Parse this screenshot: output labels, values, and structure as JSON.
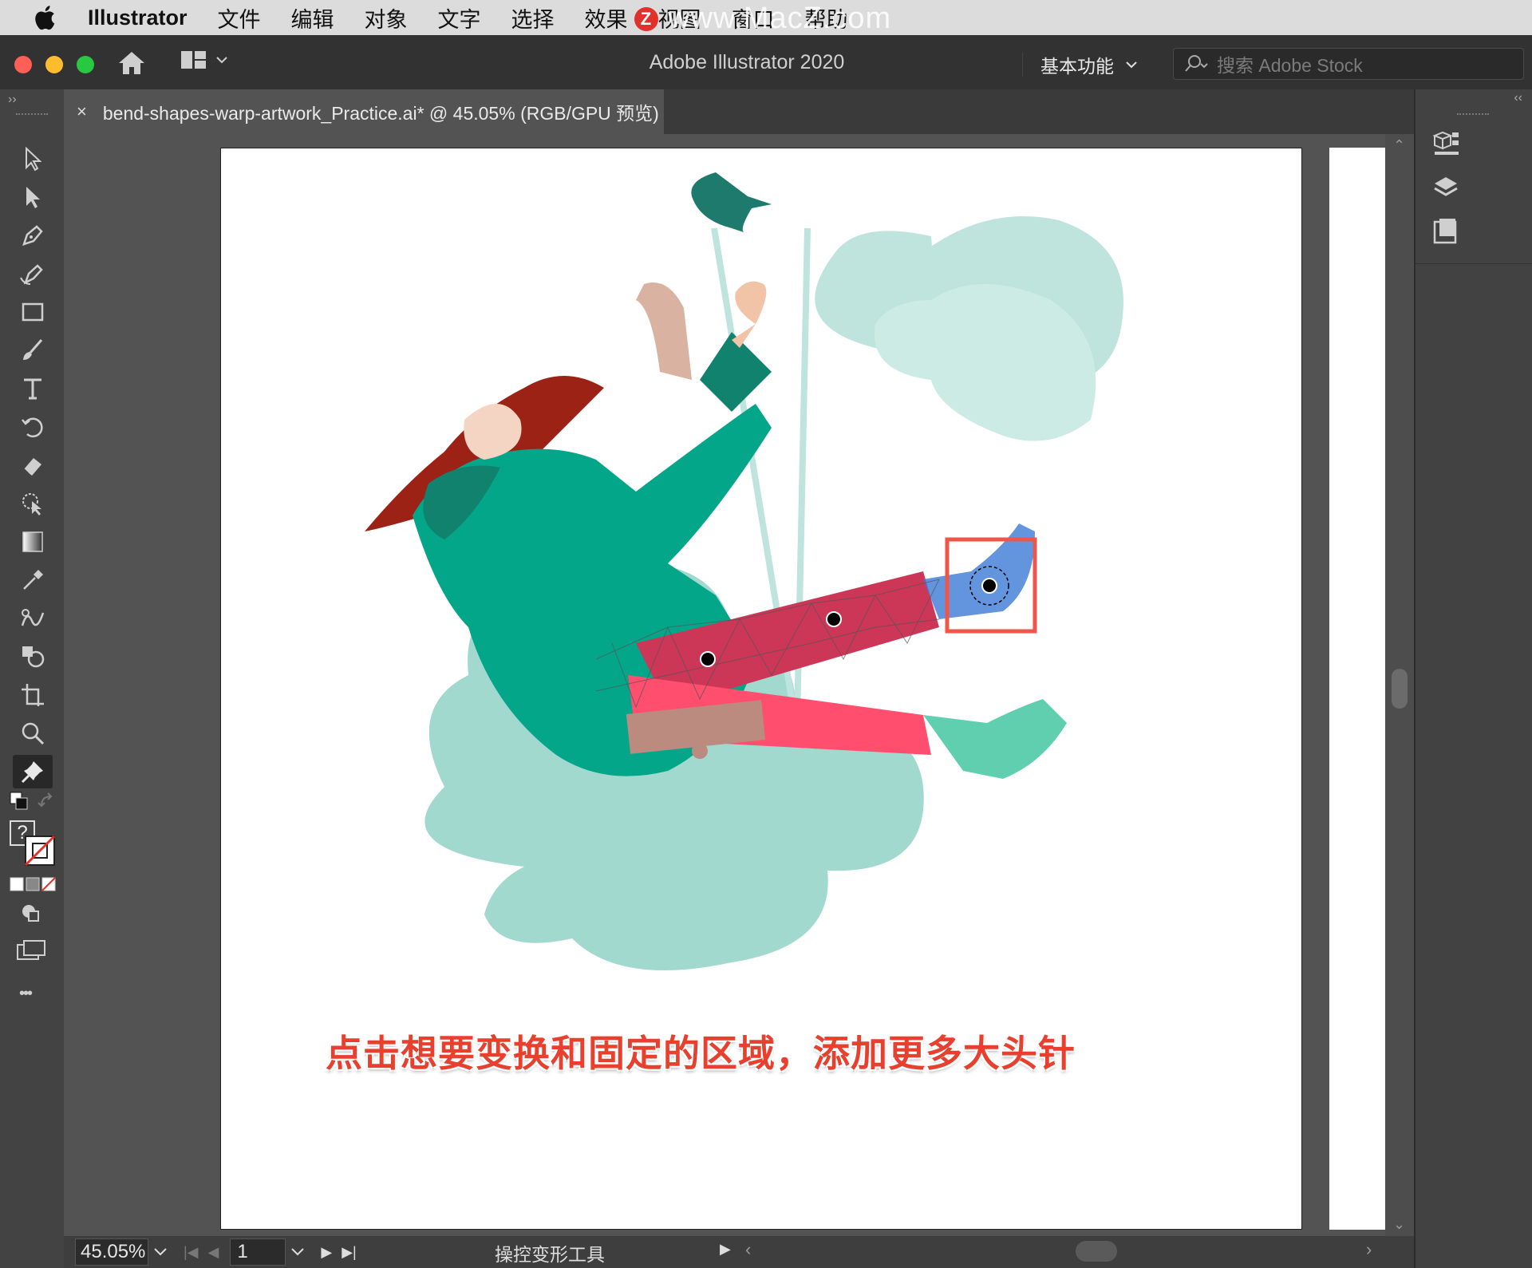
{
  "menubar": {
    "app_name": "Illustrator",
    "items": [
      "文件",
      "编辑",
      "对象",
      "文字",
      "选择",
      "效果",
      "视图",
      "窗口",
      "帮助"
    ],
    "watermark": "www.MacZ.com",
    "watermark_logo": "Z"
  },
  "titlebar": {
    "title": "Adobe Illustrator 2020",
    "workspace": "基本功能",
    "search_placeholder": "搜索 Adobe Stock"
  },
  "document": {
    "tab_label": "bend-shapes-warp-artwork_Practice.ai* @ 45.05% (RGB/GPU 预览)",
    "close_label": "×"
  },
  "caption": "点击想要变换和固定的区域，添加更多大头针",
  "statusbar": {
    "zoom": "45.05%",
    "page": "1",
    "tool_name": "操控变形工具"
  },
  "toolbar": {
    "collapse": "››",
    "fill_unknown": "?",
    "more": "•••",
    "tools": [
      "selection-tool",
      "direct-selection-tool",
      "pen-tool",
      "curvature-tool",
      "rectangle-tool",
      "paintbrush-tool",
      "type-tool",
      "rotate-tool",
      "eraser-tool",
      "shape-builder-tool",
      "gradient-tool",
      "eyedropper-tool",
      "blend-tool",
      "symbol-sprayer-tool",
      "artboard-tool",
      "zoom-tool",
      "puppet-warp-tool"
    ]
  },
  "rightpanel": {
    "collapse": "‹‹",
    "panels": [
      "libraries-icon",
      "layers-icon",
      "artboards-icon"
    ]
  },
  "colors": {
    "menubar_bg": "#dcdcdc",
    "titlebar_bg": "#323232",
    "canvas_bg": "#535353",
    "caption": "#e8402e",
    "pin_box": "#f0554a",
    "traffic_close": "#fe5f57",
    "traffic_min": "#febc2e",
    "traffic_max": "#28c840"
  }
}
